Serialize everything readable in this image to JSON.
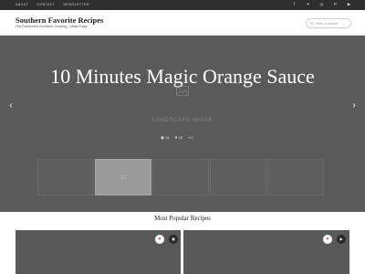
{
  "topbar": {
    "nav": [
      "ABOUT",
      "CONTACT",
      "NEWSLETTER"
    ],
    "social_icons": [
      "facebook-icon",
      "twitter-icon",
      "instagram-icon",
      "pinterest-icon",
      "youtube-icon"
    ]
  },
  "header": {
    "title": "Southern Favorite Recipes",
    "tagline": "Old-Fashioned Southern Cooking - Made Easy",
    "search_placeholder": "Enter to search"
  },
  "hero": {
    "title": "10 Minutes Magic Orange Sauce",
    "image_label": "LANDSCAPE IMAGE",
    "stats": {
      "views": "41",
      "likes": "15",
      "comments": "0"
    }
  },
  "thumbnails": {
    "count": 5,
    "active_index": 1
  },
  "popular": {
    "title": "Most Popular Recipes"
  },
  "colors": {
    "topbar": "#2f2f2f",
    "hero_bg": "#5a5a5a",
    "like_red": "#d33a4c"
  }
}
